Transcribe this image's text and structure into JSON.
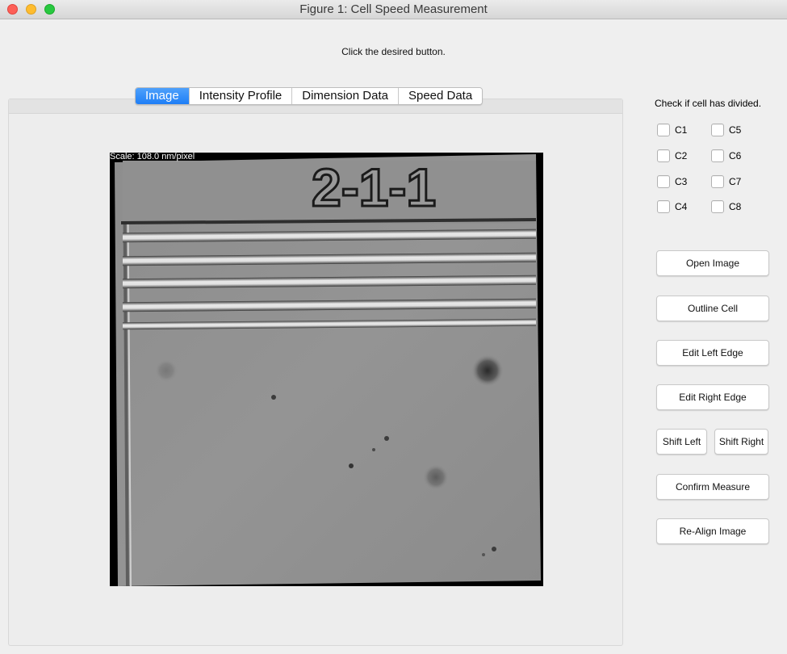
{
  "window": {
    "title": "Figure 1: Cell Speed Measurement"
  },
  "instruction": "Click the desired button.",
  "tabs": [
    {
      "label": "Image",
      "active": true
    },
    {
      "label": "Intensity Profile",
      "active": false
    },
    {
      "label": "Dimension Data",
      "active": false
    },
    {
      "label": "Speed Data",
      "active": false
    }
  ],
  "image": {
    "scale_label": "Scale: 108.0 nm/pixel",
    "channel_id": "2-1-1"
  },
  "division": {
    "heading": "Check if cell has divided.",
    "checkboxes": [
      {
        "label": "C1",
        "checked": false
      },
      {
        "label": "C2",
        "checked": false
      },
      {
        "label": "C3",
        "checked": false
      },
      {
        "label": "C4",
        "checked": false
      },
      {
        "label": "C5",
        "checked": false
      },
      {
        "label": "C6",
        "checked": false
      },
      {
        "label": "C7",
        "checked": false
      },
      {
        "label": "C8",
        "checked": false
      }
    ]
  },
  "buttons": {
    "open_image": "Open Image",
    "outline_cell": "Outline Cell",
    "edit_left_edge": "Edit Left Edge",
    "edit_right_edge": "Edit Right Edge",
    "shift_left": "Shift Left",
    "shift_right": "Shift Right",
    "confirm_measure": "Confirm Measure",
    "realign_image": "Re-Align Image"
  },
  "colors": {
    "active_tab": "#1e7ef6",
    "close": "#fd5f57",
    "minimize": "#febc2e",
    "maximize": "#28c840"
  }
}
